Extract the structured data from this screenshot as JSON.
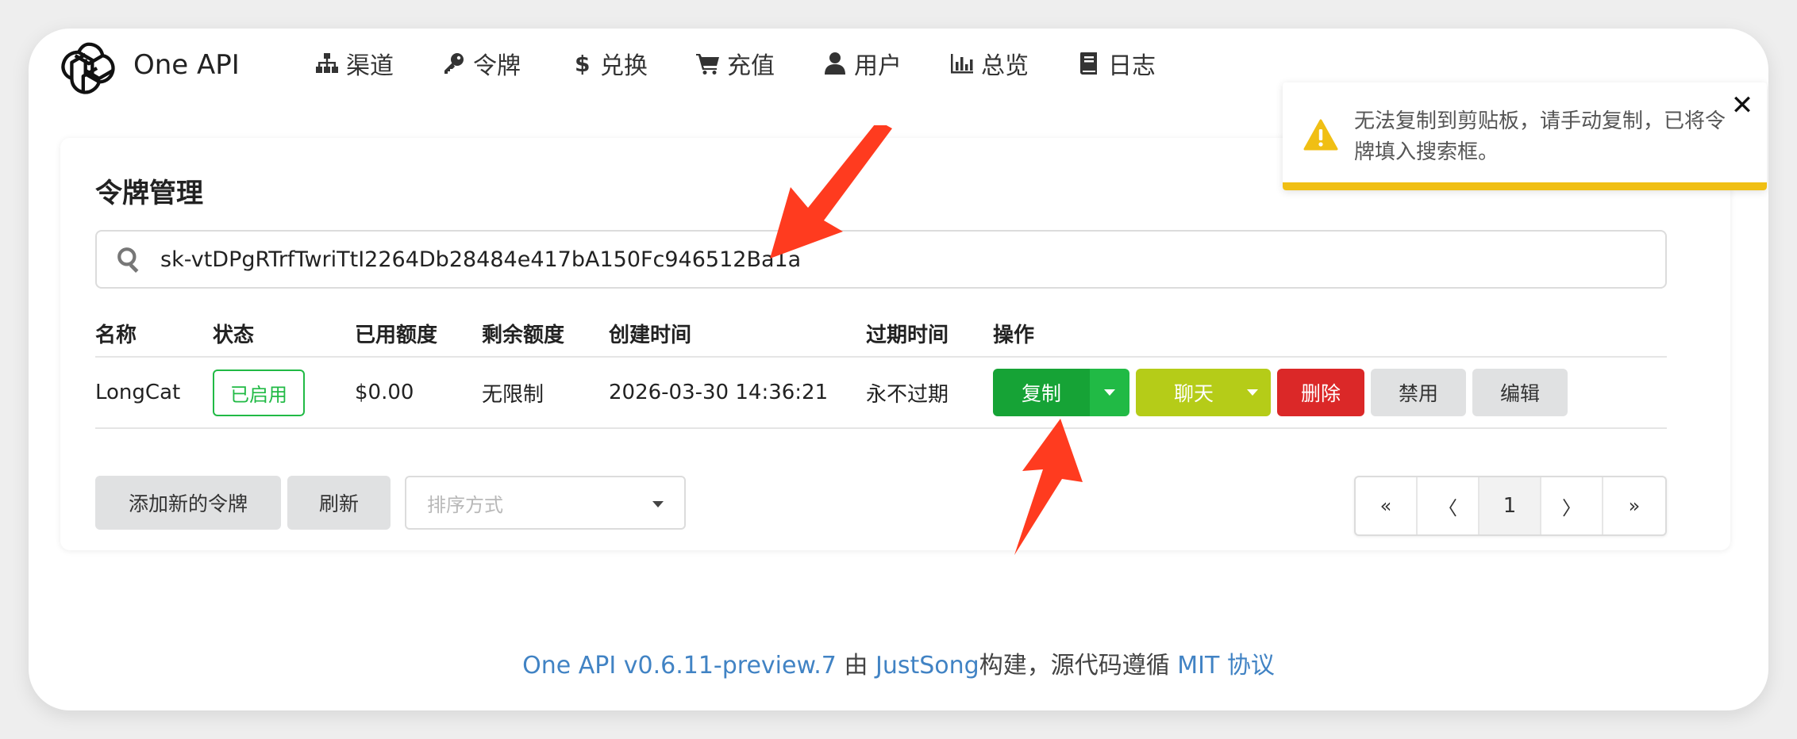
{
  "app": {
    "brand": "One API"
  },
  "nav": {
    "items": [
      {
        "label": "渠道",
        "icon": "sitemap-icon"
      },
      {
        "label": "令牌",
        "icon": "key-icon"
      },
      {
        "label": "兑换",
        "icon": "dollar-icon"
      },
      {
        "label": "充值",
        "icon": "cart-icon"
      },
      {
        "label": "用户",
        "icon": "user-icon"
      },
      {
        "label": "总览",
        "icon": "bar-chart-icon"
      },
      {
        "label": "日志",
        "icon": "book-icon"
      }
    ]
  },
  "page": {
    "title": "令牌管理"
  },
  "search": {
    "value": "sk-vtDPgRTrfTwriTtI2264Db28484e417bA150Fc946512Ba1a"
  },
  "table": {
    "headers": [
      "名称",
      "状态",
      "已用额度",
      "剩余额度",
      "创建时间",
      "过期时间",
      "操作"
    ],
    "rows": [
      {
        "name": "LongCat",
        "status": "已启用",
        "used": "$0.00",
        "remaining": "无限制",
        "created": "2026-03-30 14:36:21",
        "expires": "永不过期"
      }
    ],
    "actions": {
      "copy": "复制",
      "chat": "聊天",
      "delete": "删除",
      "disable": "禁用",
      "edit": "编辑"
    }
  },
  "toolbar": {
    "add_label": "添加新的令牌",
    "refresh_label": "刷新",
    "sort_placeholder": "排序方式"
  },
  "pagination": {
    "first": "«",
    "prev": "〈",
    "current": "1",
    "next": "〉",
    "last": "»"
  },
  "footer": {
    "version_link": "One API v0.6.11-preview.7",
    "by": "由",
    "author_link": "JustSong",
    "built": "构建，源代码遵循",
    "license_link": "MIT 协议"
  },
  "toast": {
    "message": "无法复制到剪贴板，请手动复制，已将令牌填入搜索框。",
    "close": "✕"
  },
  "colors": {
    "green": "#21ba45",
    "green_dark": "#16a336",
    "olive": "#b5cc18",
    "red": "#db2828",
    "gray_button": "#e0e1e2",
    "link": "#4183c4",
    "warning": "#f0bf14",
    "arrow": "#ff3b1f"
  }
}
